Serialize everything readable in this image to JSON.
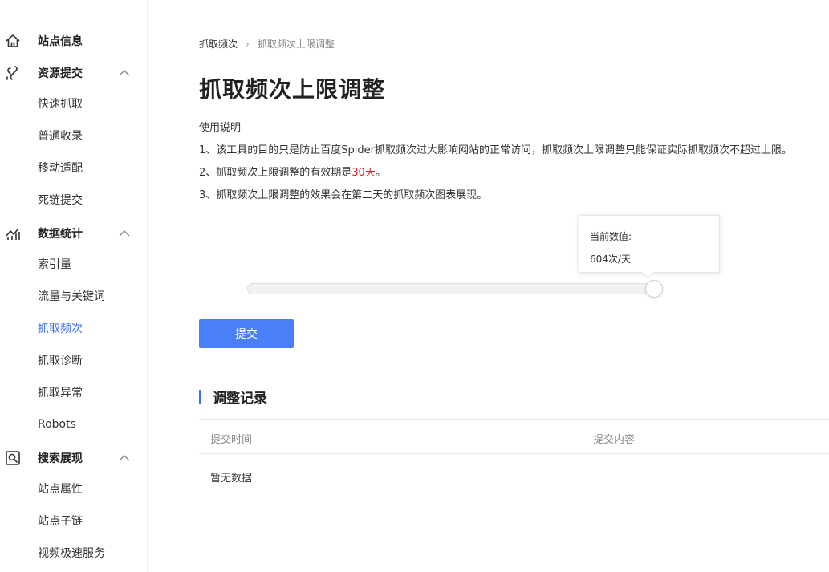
{
  "sidebar": {
    "groups": [
      {
        "label": "站点信息",
        "icon": "home-icon",
        "expanded": false
      },
      {
        "label": "资源提交",
        "icon": "link-icon",
        "expanded": true,
        "items": [
          "快速抓取",
          "普通收录",
          "移动适配",
          "死链提交"
        ]
      },
      {
        "label": "数据统计",
        "icon": "stats-icon",
        "expanded": true,
        "items": [
          "索引量",
          "流量与关键词",
          "抓取频次",
          "抓取诊断",
          "抓取异常",
          "Robots"
        ]
      },
      {
        "label": "搜索展现",
        "icon": "search-view-icon",
        "expanded": true,
        "items": [
          "站点属性",
          "站点子链",
          "视频极速服务"
        ]
      }
    ],
    "active_item": "抓取频次"
  },
  "breadcrumb": {
    "parent": "抓取频次",
    "separator": "›",
    "current": "抓取频次上限调整"
  },
  "page_title": "抓取频次上限调整",
  "instructions": {
    "heading": "使用说明",
    "line1": "1、该工具的目的只是防止百度Spider抓取频次过大影响网站的正常访问，抓取频次上限调整只能保证实际抓取频次不超过上限。",
    "line2_prefix": "2、抓取频次上限调整的有效期是",
    "line2_highlight": "30天",
    "line2_suffix": "。",
    "line3": "3、抓取频次上限调整的效果会在第二天的抓取频次图表展现。"
  },
  "slider": {
    "tooltip_label": "当前数值:",
    "tooltip_value": "604次/天",
    "value_fraction": 1.0
  },
  "submit_label": "提交",
  "records": {
    "title": "调整记录",
    "columns": [
      "提交时间",
      "提交内容"
    ],
    "empty_text": "暂无数据"
  },
  "colors": {
    "accent": "#3a6ff0",
    "button": "#4a7ff7",
    "highlight": "#e0201a"
  }
}
